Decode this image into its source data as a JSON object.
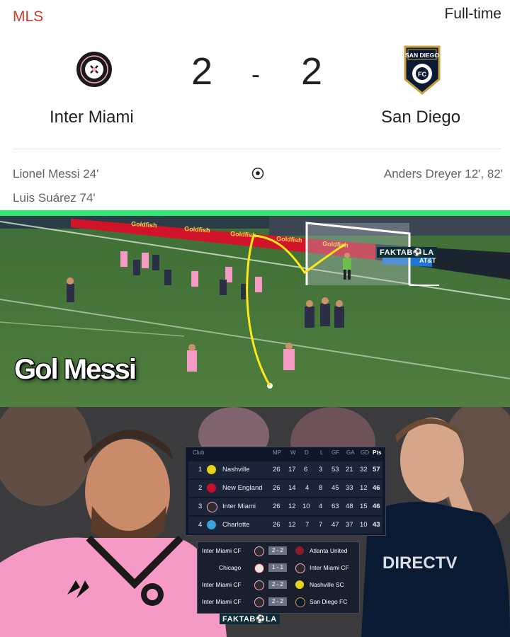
{
  "header": {
    "league": "MLS",
    "status": "Full-time"
  },
  "match": {
    "home": {
      "name": "Inter Miami",
      "score": "2",
      "crest_icon": "inter-miami-crest-icon",
      "scorers": [
        "Lionel Messi 24'",
        "Luis Suárez 74'"
      ]
    },
    "away": {
      "name": "San Diego",
      "score": "2",
      "crest_icon": "san-diego-fc-crest-icon",
      "crest_text": "SAN DIEGO",
      "scorers": [
        "Anders Dreyer 12', 82'"
      ]
    },
    "separator": "-",
    "goal_icon": "soccer-ball-icon"
  },
  "photos": {
    "caption": "Gol Messi",
    "watermark": "FAKTAB⚽LA",
    "boards": [
      "Goldfish",
      "Goldfish",
      "Goldfish",
      "Goldfish",
      "Goldfish",
      "AT&T"
    ]
  },
  "standings": {
    "headers": [
      "Club",
      "MP",
      "W",
      "D",
      "L",
      "GF",
      "GA",
      "GD",
      "Pts"
    ],
    "rows": [
      {
        "pos": "1",
        "club": "Nashville",
        "mp": "26",
        "w": "17",
        "d": "6",
        "l": "3",
        "gf": "53",
        "ga": "21",
        "gd": "32",
        "pts": "57",
        "color": "#e6d21a"
      },
      {
        "pos": "2",
        "club": "New England",
        "mp": "26",
        "w": "14",
        "d": "4",
        "l": "8",
        "gf": "45",
        "ga": "33",
        "gd": "12",
        "pts": "46",
        "color": "#c8102e"
      },
      {
        "pos": "3",
        "club": "Inter Miami",
        "mp": "26",
        "w": "12",
        "d": "10",
        "l": "4",
        "gf": "63",
        "ga": "48",
        "gd": "15",
        "pts": "46",
        "color": "#2b2b2b"
      },
      {
        "pos": "4",
        "club": "Charlotte",
        "mp": "26",
        "w": "12",
        "d": "7",
        "l": "7",
        "gf": "47",
        "ga": "37",
        "gd": "10",
        "pts": "43",
        "color": "#3aa0d8"
      }
    ]
  },
  "results": [
    {
      "home": "Inter Miami CF",
      "score": "2 - 2",
      "away": "Atlanta United"
    },
    {
      "home": "Chicago",
      "score": "1 - 1",
      "away": "Inter Miami CF"
    },
    {
      "home": "Inter Miami CF",
      "score": "2 - 2",
      "away": "Nashville SC"
    },
    {
      "home": "Inter Miami CF",
      "score": "2 - 2",
      "away": "San Diego FC"
    }
  ],
  "jersey": {
    "sponsor": "DIRECTV"
  },
  "colors": {
    "accent_green": "#2ee86f",
    "league_red": "#d0392b",
    "miami_pink": "#f7a8c8"
  }
}
